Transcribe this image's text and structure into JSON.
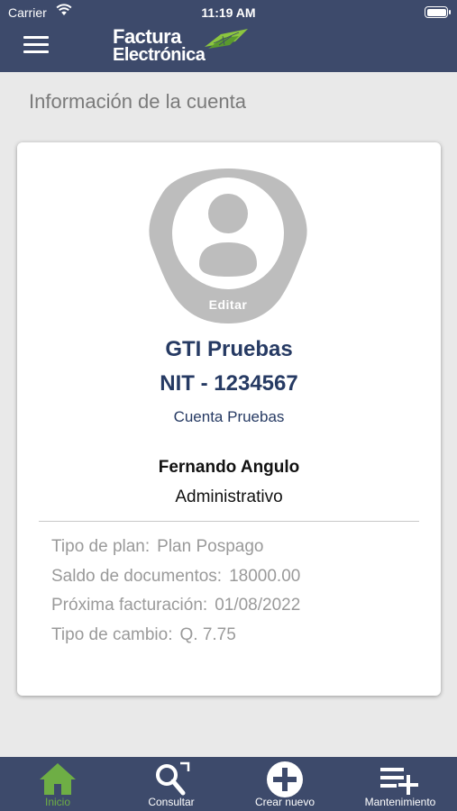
{
  "status_bar": {
    "carrier": "Carrier",
    "time": "11:19 AM"
  },
  "header": {
    "logo_line1": "Factura",
    "logo_line2": "Electrónica",
    "nav_color": "#3d4a6b",
    "logo_accent": "#8cc63f"
  },
  "page": {
    "title": "Información de la cuenta"
  },
  "profile": {
    "edit_label": "Editar",
    "company": "GTI Pruebas",
    "nit": "NIT - 1234567",
    "account_name": "Cuenta Pruebas",
    "user_name": "Fernando Angulo",
    "role": "Administrativo",
    "text_color": "#263a63"
  },
  "account_info": [
    {
      "label": "Tipo de plan:",
      "value": "Plan Pospago"
    },
    {
      "label": "Saldo de documentos:",
      "value": "18000.00"
    },
    {
      "label": "Próxima facturación:",
      "value": "01/08/2022"
    },
    {
      "label": "Tipo de cambio:",
      "value": "Q. 7.75"
    }
  ],
  "tabbar": {
    "active_color": "#6eae45",
    "tabs": [
      {
        "label": "Inicio",
        "icon": "home-icon",
        "active": true
      },
      {
        "label": "Consultar",
        "icon": "search-icon",
        "active": false
      },
      {
        "label": "Crear nuevo",
        "icon": "add-circle-icon",
        "active": false
      },
      {
        "label": "Mantenimiento",
        "icon": "list-add-icon",
        "active": false
      }
    ]
  }
}
